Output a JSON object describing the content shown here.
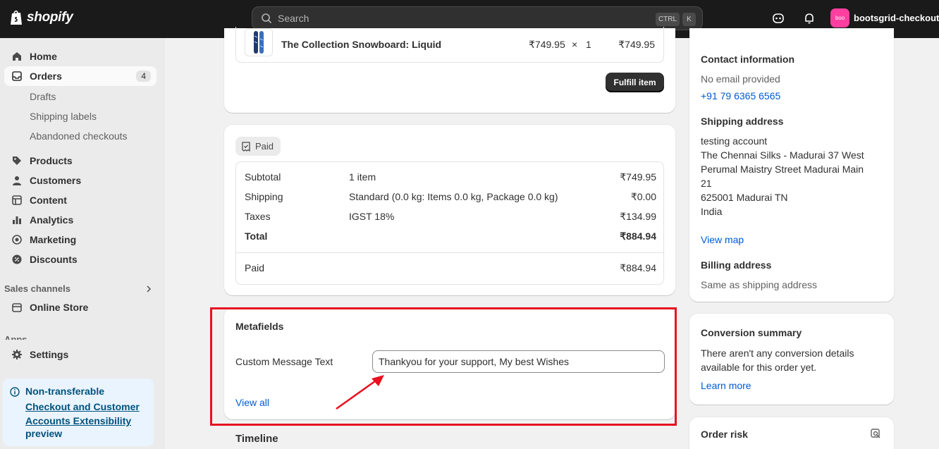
{
  "topbar": {
    "logo_text": "shopify",
    "search_placeholder": "Search",
    "shortcut_ctrl": "CTRL",
    "shortcut_k": "K",
    "store_avatar": "boo",
    "store_name": "bootsgrid-checkoutp"
  },
  "sidebar": {
    "home": "Home",
    "orders": "Orders",
    "orders_count": "4",
    "drafts": "Drafts",
    "shipping_labels": "Shipping labels",
    "abandoned_checkouts": "Abandoned checkouts",
    "products": "Products",
    "customers": "Customers",
    "content": "Content",
    "analytics": "Analytics",
    "marketing": "Marketing",
    "discounts": "Discounts",
    "sales_channels": "Sales channels",
    "online_store": "Online Store",
    "apps": "Apps",
    "settings": "Settings",
    "promo_line1": "Non-transferable",
    "promo_link": "Checkout and Customer Accounts Extensibility",
    "promo_line3": "preview"
  },
  "fulfillment": {
    "product_name": "The Collection Snowboard: Liquid",
    "unit_price": "₹749.95",
    "times": "×",
    "quantity": "1",
    "line_total": "₹749.95",
    "fulfill_button": "Fulfill item"
  },
  "payment": {
    "status": "Paid",
    "rows": [
      {
        "label": "Subtotal",
        "detail": "1 item",
        "amount": "₹749.95"
      },
      {
        "label": "Shipping",
        "detail": "Standard (0.0 kg: Items 0.0 kg, Package 0.0 kg)",
        "amount": "₹0.00"
      },
      {
        "label": "Taxes",
        "detail": "IGST 18%",
        "amount": "₹134.99"
      },
      {
        "label": "Total",
        "detail": "",
        "amount": "₹884.94"
      }
    ],
    "paid_label": "Paid",
    "paid_amount": "₹884.94"
  },
  "metafields": {
    "title": "Metafields",
    "field_label": "Custom Message Text",
    "field_value": "Thankyou for your support, My best Wishes",
    "view_all": "View all"
  },
  "timeline": {
    "title": "Timeline"
  },
  "customer": {
    "contact_title": "Contact information",
    "no_email": "No email provided",
    "phone": "+91 79 6365 6565",
    "shipping_title": "Shipping address",
    "address_lines": [
      "testing account",
      "The Chennai Silks - Madurai 37 West",
      "Perumal Maistry Street Madurai Main",
      "21",
      "625001 Madurai TN",
      "India"
    ],
    "view_map": "View map",
    "billing_title": "Billing address",
    "billing_value": "Same as shipping address"
  },
  "conversion": {
    "title": "Conversion summary",
    "text": "There aren't any conversion details available for this order yet.",
    "learn_more": "Learn more"
  },
  "risk": {
    "title": "Order risk"
  },
  "colors": {
    "accent_link": "#005bd3",
    "highlight": "#e8101f",
    "topbar": "#1a1a1a"
  }
}
